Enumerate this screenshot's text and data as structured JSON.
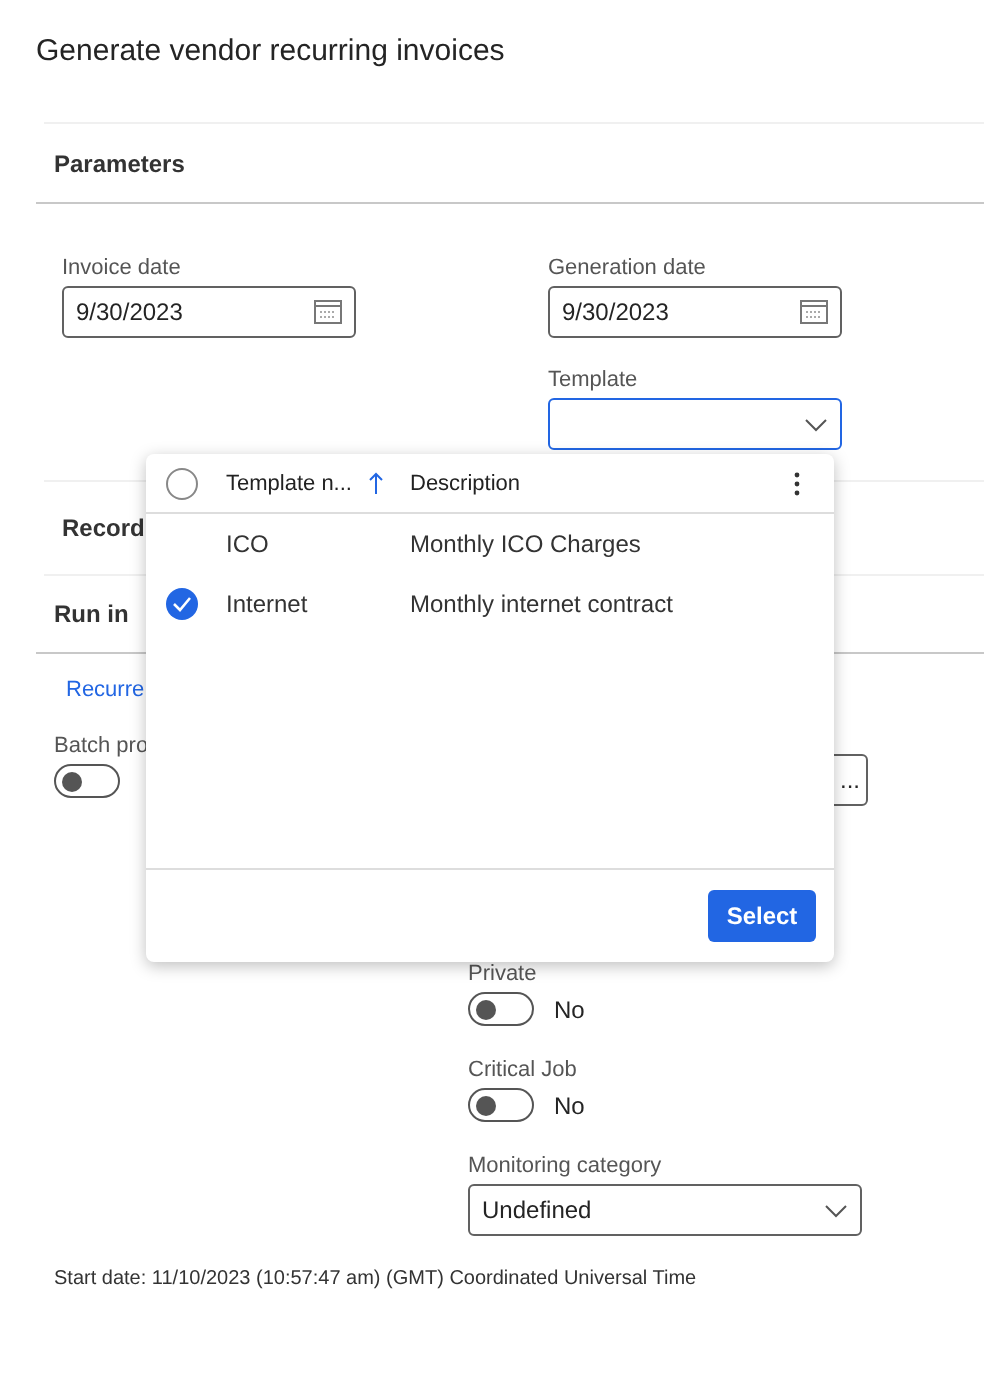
{
  "title": "Generate vendor recurring invoices",
  "sections": [
    {
      "title": "Parameters"
    }
  ],
  "parameters": {
    "invoice_date": {
      "label": "Invoice date",
      "value": "9/30/2023"
    },
    "generation_date": {
      "label": "Generation date",
      "value": "9/30/2023"
    },
    "template": {
      "label": "Template",
      "focused": true
    }
  },
  "collapsed_sections": [
    {
      "title": "Record"
    },
    {
      "title": "Run in"
    }
  ],
  "run_in": {
    "tab": "Recurre",
    "batch": {
      "label": "Batch pro",
      "on": false
    },
    "lookup_button": "...",
    "toggles": [
      {
        "label": "Private",
        "on": false,
        "state_text": "No"
      },
      {
        "label": "Critical Job",
        "on": false,
        "state_text": "No"
      }
    ],
    "monitoring_category": {
      "label": "Monitoring category",
      "value": "Undefined"
    }
  },
  "start_date": "Start date: 11/10/2023 (10:57:47 am) (GMT) Coordinated Universal Time",
  "lookup": {
    "columns": [
      "Template n...",
      "Description"
    ],
    "all_selected": false,
    "rows": [
      {
        "cells": [
          "ICO",
          "Monthly ICO Charges"
        ],
        "selected": false
      },
      {
        "cells": [
          "Internet",
          "Monthly internet contract"
        ],
        "selected": true
      }
    ],
    "button": "Select"
  }
}
